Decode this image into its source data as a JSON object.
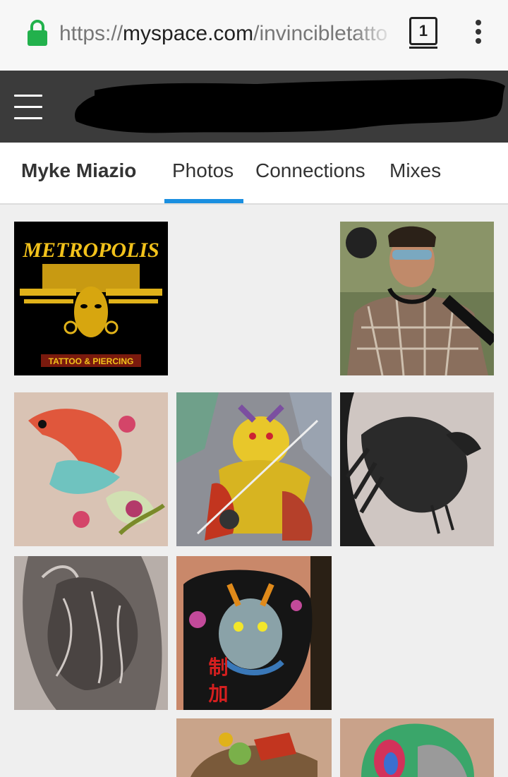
{
  "browser": {
    "url_prefix": "https://",
    "url_domain": "myspace.com",
    "url_path": "/invincibletatto",
    "tab_count": "1",
    "icons": [
      "lock-icon",
      "tab-switcher-icon",
      "overflow-menu-icon"
    ]
  },
  "site_header": {
    "menu_icon": "hamburger-menu-icon"
  },
  "profile_nav": {
    "name": "Myke Miazio",
    "tabs": [
      {
        "label": "Photos",
        "active": true
      },
      {
        "label": "Connections",
        "active": false
      },
      {
        "label": "Mixes",
        "active": false
      }
    ],
    "active_color": "#1a8fe0"
  },
  "photos": {
    "metropolis_logo": {
      "title": "METROPOLIS",
      "subtitle": "TATTOO & PIERCING"
    },
    "dragon_text": "制 加"
  },
  "colors": {
    "header_bg": "#3b3b3b",
    "grid_bg": "#efefef",
    "lock_green": "#22b14c"
  }
}
